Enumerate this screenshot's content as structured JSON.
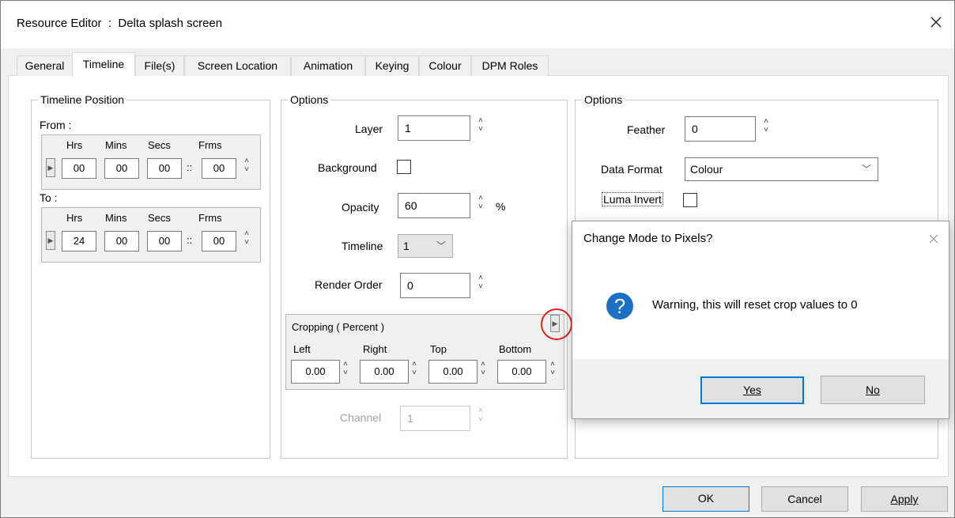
{
  "window": {
    "title": "Resource Editor  :  Delta splash screen"
  },
  "tabs": [
    {
      "label": "General"
    },
    {
      "label": "Timeline"
    },
    {
      "label": "File(s)"
    },
    {
      "label": "Screen Location"
    },
    {
      "label": "Animation"
    },
    {
      "label": "Keying"
    },
    {
      "label": "Colour"
    },
    {
      "label": "DPM Roles"
    }
  ],
  "timeline_position": {
    "title": "Timeline Position",
    "from_label": "From :",
    "to_label": "To :",
    "headers": [
      "Hrs",
      "Mins",
      "Secs",
      "Frms"
    ],
    "from": [
      "00",
      "00",
      "00",
      "00"
    ],
    "to": [
      "24",
      "00",
      "00",
      "00"
    ],
    "separator": "::"
  },
  "options_mid": {
    "title": "Options",
    "layer_label": "Layer",
    "layer_value": "1",
    "background_label": "Background",
    "background_checked": false,
    "opacity_label": "Opacity",
    "opacity_value": "60",
    "opacity_unit": "%",
    "timeline_label": "Timeline",
    "timeline_value": "1",
    "render_order_label": "Render Order",
    "render_order_value": "0",
    "cropping": {
      "title": "Cropping ( Percent )",
      "headers": [
        "Left",
        "Right",
        "Top",
        "Bottom"
      ],
      "values": [
        "0.00",
        "0.00",
        "0.00",
        "0.00"
      ]
    },
    "channel_label": "Channel",
    "channel_value": "1"
  },
  "options_right": {
    "title": "Options",
    "feather_label": "Feather",
    "feather_value": "0",
    "data_format_label": "Data Format",
    "data_format_value": "Colour",
    "luma_invert_label": "Luma Invert",
    "luma_invert_checked": false
  },
  "dialog": {
    "title": "Change Mode to Pixels?",
    "message": "Warning, this will reset crop values to 0",
    "yes_label": "Yes",
    "no_label": "No",
    "icon": "question-icon",
    "icon_color": "#1b6fc4"
  },
  "footer": {
    "ok_label": "OK",
    "cancel_label": "Cancel",
    "apply_label": "Apply"
  },
  "colors": {
    "accent": "#0078d7",
    "highlight_circle": "#e02020"
  }
}
